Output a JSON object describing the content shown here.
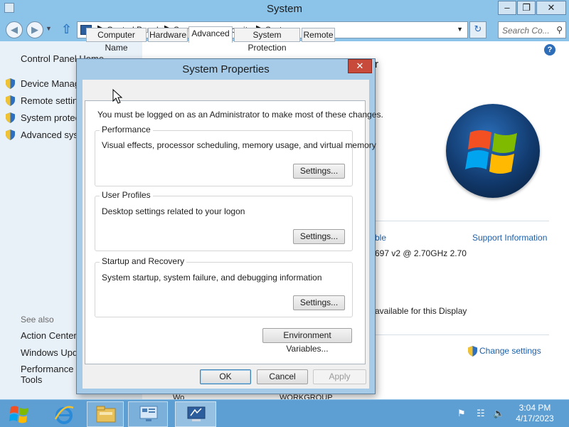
{
  "window": {
    "title": "System",
    "controls": {
      "minimize": "–",
      "maximize": "❐",
      "close": "✕"
    }
  },
  "navbar": {
    "breadcrumb": [
      "Control Panel",
      "System and Security",
      "System"
    ],
    "search_placeholder": "Search Co..."
  },
  "leftpane": {
    "home": "Control Panel Home",
    "links": [
      "Device Manag",
      "Remote setting",
      "System protect",
      "Advanced syst"
    ],
    "see_also": "See also",
    "see_also_links": [
      "Action Center",
      "Windows Upda",
      "Performance In",
      "Tools"
    ]
  },
  "content": {
    "partial_heading": "r",
    "processor_link_partial": "ble",
    "support_link": "Support Information",
    "processor_text": "697 v2 @ 2.70GHz   2.70",
    "display_text": "available for this Display",
    "change_settings": "Change settings",
    "workgroup_partial_left": "Wo",
    "workgroup_partial_right": "WORKGROUP"
  },
  "dialog": {
    "title": "System Properties",
    "close": "✕",
    "tabs": [
      "Computer Name",
      "Hardware",
      "Advanced",
      "System Protection",
      "Remote"
    ],
    "active_tab": "Advanced",
    "admin_note": "You must be logged on as an Administrator to make most of these changes.",
    "groups": [
      {
        "label": "Performance",
        "description": "Visual effects, processor scheduling, memory usage, and virtual memory",
        "button": "Settings..."
      },
      {
        "label": "User Profiles",
        "description": "Desktop settings related to your logon",
        "button": "Settings..."
      },
      {
        "label": "Startup and Recovery",
        "description": "System startup, system failure, and debugging information",
        "button": "Settings..."
      }
    ],
    "env_button": "Environment Variables...",
    "ok": "OK",
    "cancel": "Cancel",
    "apply": "Apply"
  },
  "taskbar": {
    "time": "3:04 PM",
    "date": "4/17/2023"
  },
  "colors": {
    "accent": "#8cc3e8",
    "link": "#1d5fa8",
    "taskbar": "#5e9fd3"
  }
}
